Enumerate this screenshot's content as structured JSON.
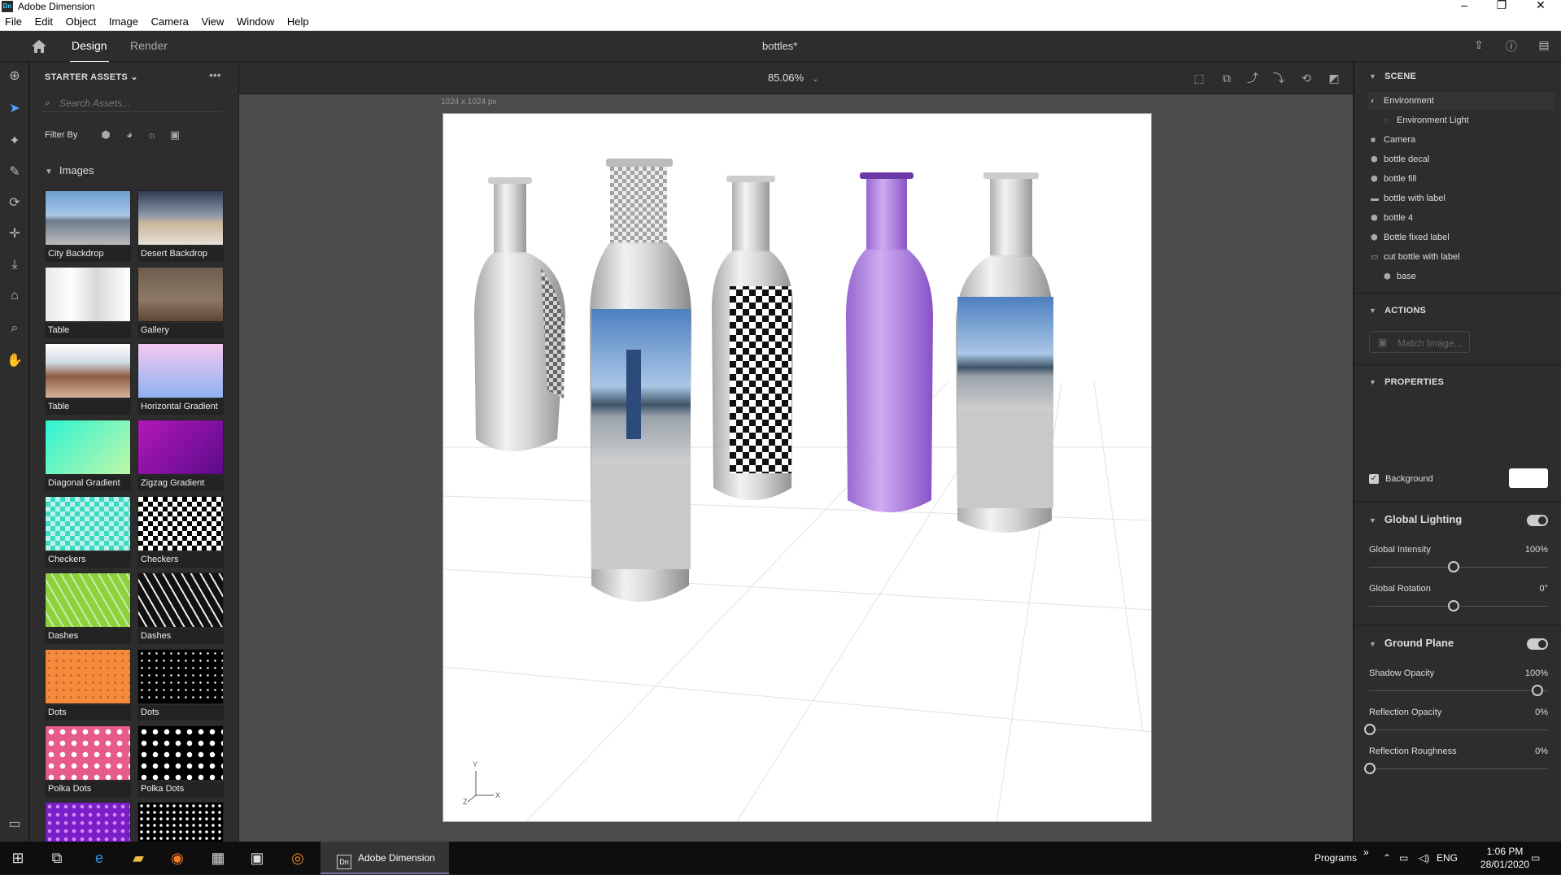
{
  "window": {
    "title": "Adobe Dimension",
    "logo": "Dn",
    "minimize": "–",
    "restore": "❐",
    "close": "✕"
  },
  "menu": [
    "File",
    "Edit",
    "Object",
    "Image",
    "Camera",
    "View",
    "Window",
    "Help"
  ],
  "tabs": {
    "design": "Design",
    "render": "Render",
    "document_title": "bottles*"
  },
  "assets": {
    "header": "STARTER ASSETS",
    "search_placeholder": "Search Assets...",
    "filter_label": "Filter By",
    "section": "Images",
    "items": [
      {
        "label": "City Backdrop",
        "style": "linear-gradient(#6d9ecf 0%,#a9c7e6 45%,#6c7c8a 55%,#bcbcbc 100%)"
      },
      {
        "label": "Desert Backdrop",
        "style": "linear-gradient(#2f3d55 0%,#8c97a8 45%,#c9b69a 60%,#e6e1d9 100%)"
      },
      {
        "label": "Table",
        "style": "linear-gradient(90deg,#e8e8e8,#fff 30%,#d9d9d9 60%,#fff),linear-gradient(#fff,#bbb)"
      },
      {
        "label": "Gallery",
        "style": "linear-gradient(#6e5d4e 0%,#8d7866 60%,#5c4637 100%)"
      },
      {
        "label": "Table",
        "style": "linear-gradient(#fff 0%,#cfd9e2 35%,#8f5c43 60%,#d4b39a 100%)"
      },
      {
        "label": "Horizontal Gradient",
        "style": "linear-gradient(#f3c9ef,#8fb2f0)"
      },
      {
        "label": "Diagonal Gradient",
        "style": "linear-gradient(135deg,#2ef3d4,#c0f7a8)"
      },
      {
        "label": "Zigzag Gradient",
        "style": "linear-gradient(135deg,#b319b8,#5a0a8a)"
      },
      {
        "label": "Checkers",
        "style": "repeating-conic-gradient(#3dd8c3 0 25%,#b8f3ea 0 50%) 0 0/12px 12px"
      },
      {
        "label": "Checkers",
        "style": "repeating-conic-gradient(#000 0 25%,#fff 0 50%) 0 0/12px 12px"
      },
      {
        "label": "Dashes",
        "style": "repeating-linear-gradient(60deg,#8bd23c 0 8px,#cfe9a8 8px 10px)"
      },
      {
        "label": "Dashes",
        "style": "repeating-linear-gradient(60deg,#111 0 8px,#eee 8px 10px)"
      },
      {
        "label": "Dots",
        "style": "radial-gradient(#b85a1e 1px,transparent 1.5px) 0 0/9px 9px,#f58a3c"
      },
      {
        "label": "Dots",
        "style": "radial-gradient(#fff 1px,transparent 1.5px) 0 0/9px 9px,#000"
      },
      {
        "label": "Polka Dots",
        "style": "radial-gradient(#fff 3px,transparent 3.5px) 0 0/14px 14px,#e65a8c"
      },
      {
        "label": "Polka Dots",
        "style": "radial-gradient(#fff 3px,transparent 3.5px) 0 0/14px 14px,#000"
      },
      {
        "label": "",
        "style": "radial-gradient(#d38cf5 2px,transparent 2.5px) 0 0/10px 10px,#7a1fc7"
      },
      {
        "label": "",
        "style": "radial-gradient(#fff 1.5px,transparent 2px) 0 0/8px 8px,#000"
      }
    ]
  },
  "viewport": {
    "zoom": "85.06%",
    "canvas_size": "1024 x 1024 px"
  },
  "scene": {
    "header": "SCENE",
    "items": [
      {
        "label": "Environment",
        "icon": "◐",
        "indent": 0,
        "selected": true
      },
      {
        "label": "Environment Light",
        "icon": "◌",
        "indent": 1
      },
      {
        "label": "Camera",
        "icon": "■",
        "indent": 0
      },
      {
        "label": "bottle decal",
        "icon": "⬢",
        "indent": 0
      },
      {
        "label": "bottle fill",
        "icon": "⬢",
        "indent": 0
      },
      {
        "label": "bottle with label",
        "icon": "▬",
        "indent": 0
      },
      {
        "label": "bottle 4",
        "icon": "⬢",
        "indent": 0
      },
      {
        "label": "Bottle fixed label",
        "icon": "⬢",
        "indent": 0
      },
      {
        "label": "cut bottle with label",
        "icon": "▭",
        "indent": 0
      },
      {
        "label": "base",
        "icon": "⬢",
        "indent": 1
      }
    ]
  },
  "actions": {
    "header": "ACTIONS",
    "match_image": "Match Image..."
  },
  "properties": {
    "header": "PROPERTIES",
    "background": "Background",
    "global_lighting": "Global Lighting",
    "global_intensity": {
      "label": "Global Intensity",
      "value": "100%",
      "level": 0.5
    },
    "global_rotation": {
      "label": "Global Rotation",
      "value": "0°",
      "level": 0.5
    },
    "ground_plane": "Ground Plane",
    "shadow_opacity": {
      "label": "Shadow Opacity",
      "value": "100%",
      "level": 1.0
    },
    "reflection_opacity": {
      "label": "Reflection Opacity",
      "value": "0%",
      "level": 0.0
    },
    "reflection_roughness": {
      "label": "Reflection Roughness",
      "value": "0%",
      "level": 0.0
    }
  },
  "axis": {
    "y": "Y",
    "x": "X",
    "z": "Z"
  },
  "taskbar": {
    "app": "Adobe Dimension",
    "programs": "Programs",
    "more": "»",
    "lang": "ENG",
    "time": "1:06 PM",
    "date": "28/01/2020"
  }
}
